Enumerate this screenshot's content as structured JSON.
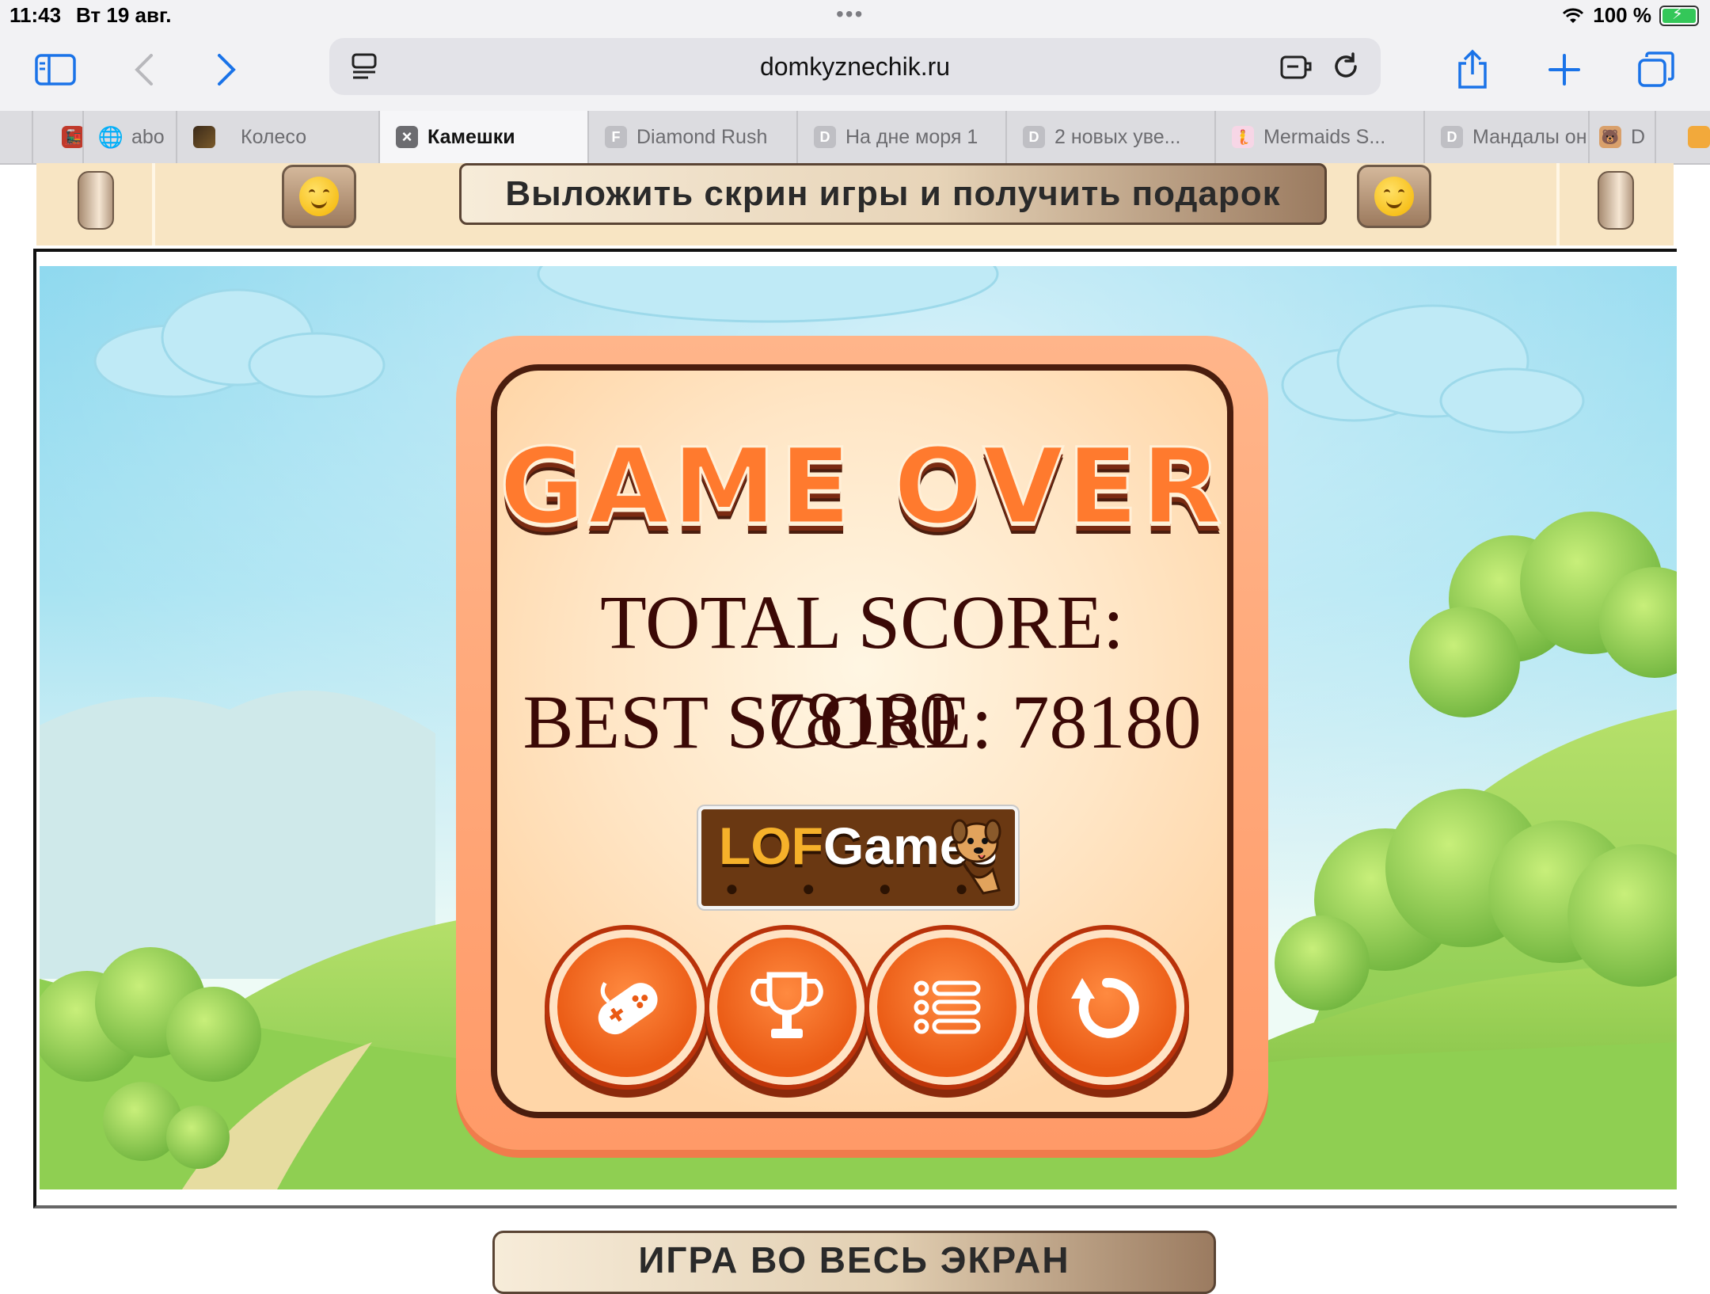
{
  "status": {
    "time": "11:43",
    "date": "Вт 19 авг.",
    "battery": "100 %"
  },
  "browser": {
    "url": "domkyznechik.ru",
    "icons": {
      "sidebar": "sidebar-icon",
      "back": "chevron-left-icon",
      "forward": "chevron-right-icon",
      "reader": "reader-icon",
      "extension": "extension-icon",
      "reload": "reload-icon",
      "share": "share-icon",
      "new_tab": "plus-icon",
      "tabs": "tabs-icon"
    }
  },
  "tabs": [
    {
      "label": "",
      "favicon": "🚂"
    },
    {
      "label": "abo",
      "favicon": "🌐"
    },
    {
      "label": "Колесо",
      "favicon": ""
    },
    {
      "label": "Камешки",
      "favicon": "×",
      "active": true
    },
    {
      "label": "Diamond Rush",
      "favicon": "F"
    },
    {
      "label": "На дне моря 1",
      "favicon": "D"
    },
    {
      "label": "2 новых уве...",
      "favicon": "D"
    },
    {
      "label": "Mermaids S...",
      "favicon": "🧜"
    },
    {
      "label": "Мандалы он",
      "favicon": "D"
    },
    {
      "label": "D",
      "favicon": "🐻"
    },
    {
      "label": "",
      "favicon": "🍂"
    }
  ],
  "promo": {
    "banner": "Выложить скрин игры и получить подарок"
  },
  "game": {
    "title": "GAME OVER",
    "total_score_label": "TOTAL SCORE:",
    "total_score_value": "78180",
    "best_score": "BEST SCORE: 78180",
    "logo": {
      "lo": "LOF",
      "rest": "Games"
    },
    "buttons": [
      "more-games-button",
      "leaderboard-button",
      "menu-button",
      "restart-button"
    ]
  },
  "fullscreen": {
    "label": "ИГРА ВО ВЕСЬ ЭКРАН"
  }
}
